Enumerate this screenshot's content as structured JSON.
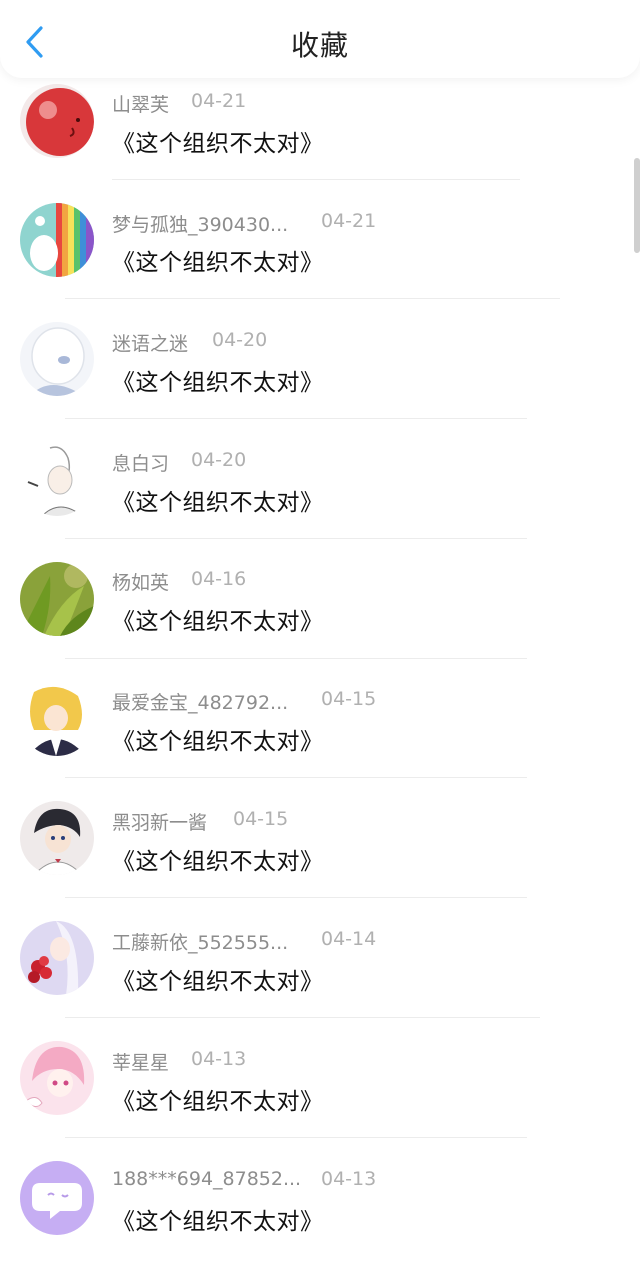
{
  "header": {
    "title": "收藏",
    "back_icon": "chevron-left-icon",
    "accent_color": "#2f9cf2"
  },
  "items": [
    {
      "name": "山翠芙",
      "date": "04-21",
      "text": "《这个组织不太对》",
      "avatar": "red-ball-avatar"
    },
    {
      "name": "梦与孤独_390430...",
      "date": "04-21",
      "text": "《这个组织不太对》",
      "avatar": "rainbow-pony-avatar"
    },
    {
      "name": "迷语之迷",
      "date": "04-20",
      "text": "《这个组织不太对》",
      "avatar": "white-haired-girl-avatar"
    },
    {
      "name": "息白习",
      "date": "04-20",
      "text": "《这个组织不太对》",
      "avatar": "sketch-girl-avatar"
    },
    {
      "name": "杨如英",
      "date": "04-16",
      "text": "《这个组织不太对》",
      "avatar": "green-grass-avatar"
    },
    {
      "name": "最爱金宝_482792...",
      "date": "04-15",
      "text": "《这个组织不太对》",
      "avatar": "blonde-anime-avatar"
    },
    {
      "name": "黑羽新一酱",
      "date": "04-15",
      "text": "《这个组织不太对》",
      "avatar": "dark-haired-boy-avatar"
    },
    {
      "name": "工藤新依_552555...",
      "date": "04-14",
      "text": "《这个组织不太对》",
      "avatar": "rose-girl-avatar"
    },
    {
      "name": "莘星星",
      "date": "04-13",
      "text": "《这个组织不太对》",
      "avatar": "pink-girl-avatar"
    },
    {
      "name": "188***694_87852...",
      "date": "04-13",
      "text": "《这个组织不太对》",
      "avatar": "chat-bubble-avatar"
    }
  ]
}
